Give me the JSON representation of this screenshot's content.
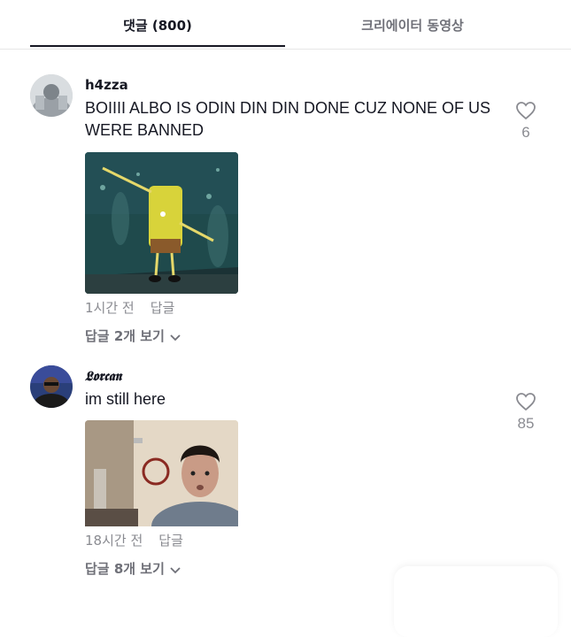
{
  "tabs": {
    "comments_label": "댓글 (800)",
    "creator_label": "크리에이터 동영상"
  },
  "comments": [
    {
      "username": "h4zza",
      "text": "BOIIII ALBO IS ODIN DIN DIN DONE CUZ NONE OF US WERE BANNED",
      "time": "1시간 전",
      "reply_label": "답글",
      "view_replies_label": "답글 2개 보기",
      "likes": "6"
    },
    {
      "username": "𝕷𝖔𝖗𝖈𝖆𝖓",
      "text": "im still here",
      "time": "18시간 전",
      "reply_label": "답글",
      "view_replies_label": "답글 8개 보기",
      "likes": "85"
    }
  ],
  "icons": {
    "like": "heart-outline-icon",
    "expand": "chevron-down-icon"
  },
  "colors": {
    "text_primary": "#161823",
    "text_secondary": "#8a8b91",
    "tab_inactive": "#6f7078",
    "divider": "#e6e6e6"
  }
}
